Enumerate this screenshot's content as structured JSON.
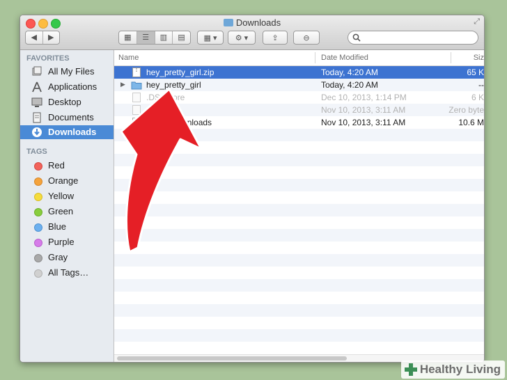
{
  "window": {
    "title": "Downloads"
  },
  "search": {
    "placeholder": ""
  },
  "sidebar": {
    "favorites_header": "FAVORITES",
    "favorites": [
      {
        "label": "All My Files",
        "icon": "all-files-icon"
      },
      {
        "label": "Applications",
        "icon": "applications-icon"
      },
      {
        "label": "Desktop",
        "icon": "desktop-icon"
      },
      {
        "label": "Documents",
        "icon": "documents-icon"
      },
      {
        "label": "Downloads",
        "icon": "downloads-icon",
        "selected": true
      }
    ],
    "tags_header": "TAGS",
    "tags": [
      {
        "label": "Red",
        "color": "#f2625a"
      },
      {
        "label": "Orange",
        "color": "#f4a33d"
      },
      {
        "label": "Yellow",
        "color": "#f5dc3d"
      },
      {
        "label": "Green",
        "color": "#88cd3e"
      },
      {
        "label": "Blue",
        "color": "#6cb0ef"
      },
      {
        "label": "Purple",
        "color": "#d67ce9"
      },
      {
        "label": "Gray",
        "color": "#a9a9a9"
      },
      {
        "label": "All Tags…",
        "color": "#d0d0d0"
      }
    ]
  },
  "columns": {
    "name": "Name",
    "date": "Date Modified",
    "size": "Siz"
  },
  "files": [
    {
      "name": "hey_pretty_girl.zip",
      "date": "Today, 4:20 AM",
      "size": "65 K",
      "selected": true
    },
    {
      "name": "hey_pretty_girl",
      "date": "Today, 4:20 AM",
      "size": "--",
      "folder": true
    },
    {
      "name": ".DS_Store",
      "date": "Dec 10, 2013, 1:14 PM",
      "size": "6 K",
      "dim": true
    },
    {
      "name": ".l",
      "date": "Nov 10, 2013, 3:11 AM",
      "size": "Zero byte",
      "dim": true
    },
    {
      "name": "About Downloads",
      "date": "Nov 10, 2013, 3:11 AM",
      "size": "10.6 M"
    }
  ],
  "watermark": {
    "text": "Healthy Living"
  },
  "colors": {
    "selection": "#3d73d1",
    "arrow": "#e51f26",
    "background": "#a9c49a"
  }
}
